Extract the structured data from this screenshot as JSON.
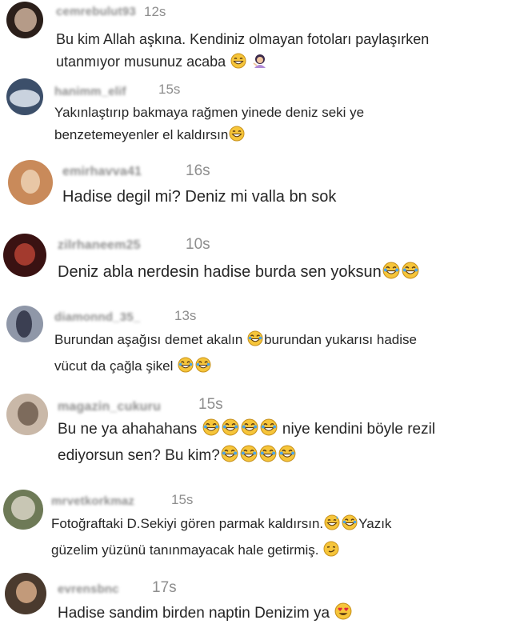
{
  "comments": [
    {
      "username": "cemrebulut93",
      "time": "12s",
      "lines": [
        "Bu kim Allah aşkına. Kendiniz olmayan fotoları paylaşırken",
        "utanmıyor musunuz acaba"
      ],
      "emojis": [
        [],
        [
          "grin",
          "woman-gesture"
        ]
      ],
      "avatar_colors": [
        "#2b1f1a",
        "#b59b88"
      ]
    },
    {
      "username": "hanimm_elif",
      "time": "15s",
      "lines": [
        "Yakınlaştırıp bakmaya rağmen yinede deniz seki ye",
        "benzetemeyenler el kaldırsın"
      ],
      "emojis": [
        [],
        [
          "grin"
        ]
      ],
      "avatar_colors": [
        "#3c4f6a",
        "#c9d2de"
      ]
    },
    {
      "username": "emirhavva41",
      "time": "16s",
      "lines": [
        "Hadise degil mi? Deniz mi valla bn sok"
      ],
      "emojis": [
        []
      ],
      "avatar_colors": [
        "#c98a5a",
        "#e8c7a6"
      ]
    },
    {
      "username": "zilrhaneem25",
      "time": "10s",
      "lines": [
        "Deniz abla nerdesin hadise burda sen yoksun"
      ],
      "emojis": [
        [
          "joy",
          "joy"
        ]
      ],
      "avatar_colors": [
        "#3a1212",
        "#a33a2e"
      ]
    },
    {
      "username": "diamonnd_35_",
      "time": "13s",
      "lines": [
        "Burundan aşağısı demet akalın",
        "burundan yukarısı hadise",
        "vücut da çağla şikel"
      ],
      "emojis": [
        [],
        [],
        [
          "joy",
          "joy"
        ]
      ],
      "avatar_colors": [
        "#8f97a8",
        "#3b3f52"
      ]
    },
    {
      "username": "magazin_cukuru",
      "time": "15s",
      "lines": [
        "Bu ne ya ahahahans",
        "niye kendini böyle rezil",
        "ediyorsun sen? Bu kim?"
      ],
      "emojis": [
        [
          "joy",
          "joy",
          "joy",
          "joy"
        ],
        [],
        [
          "joy",
          "joy",
          "joy",
          "joy"
        ]
      ],
      "avatar_colors": [
        "#c9b8a8",
        "#7d6b5c"
      ]
    },
    {
      "username": "mrvetkorkmaz",
      "time": "15s",
      "lines": [
        "Fotoğraftaki D.Sekiyi gören parmak kaldırsın.",
        "Yazık",
        "güzelim yüzünü tanınmayacak hale getirmiş."
      ],
      "emojis": [
        [
          "sweat-smile",
          "joy"
        ],
        [],
        [
          "smirk"
        ]
      ],
      "avatar_colors": [
        "#6e7a57",
        "#c8c6b4"
      ]
    },
    {
      "username": "evrensbnc",
      "time": "17s",
      "lines": [
        "Hadise sandim birden naptin Denizim ya"
      ],
      "emojis": [
        [
          "heart-eyes"
        ]
      ],
      "avatar_colors": [
        "#4a3a2e",
        "#c29a7a"
      ]
    }
  ]
}
